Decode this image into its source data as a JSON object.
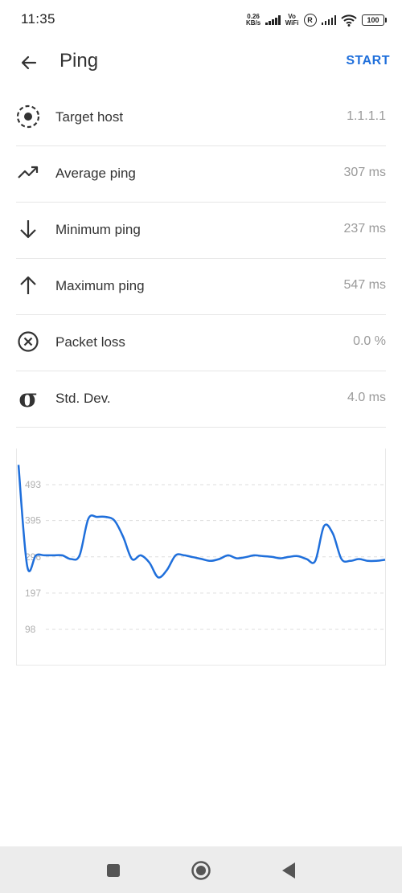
{
  "status_bar": {
    "time": "11:35",
    "speed_value": "0.26",
    "speed_unit": "KB/s",
    "volte_top": "Vo",
    "volte_bottom": "WiFi",
    "roaming": "R",
    "battery": "100"
  },
  "app_bar": {
    "title": "Ping",
    "action_label": "START"
  },
  "stats": [
    {
      "label": "Target host",
      "value": "1.1.1.1",
      "icon": "target-icon"
    },
    {
      "label": "Average ping",
      "value": "307 ms",
      "icon": "trending-up-icon"
    },
    {
      "label": "Minimum ping",
      "value": "237 ms",
      "icon": "arrow-down-icon"
    },
    {
      "label": "Maximum ping",
      "value": "547 ms",
      "icon": "arrow-up-icon"
    },
    {
      "label": "Packet loss",
      "value": "0.0 %",
      "icon": "cancel-circle-icon"
    },
    {
      "label": "Std. Dev.",
      "value": "4.0 ms",
      "icon": "sigma-icon",
      "symbol": "σ"
    }
  ],
  "chart_data": {
    "type": "line",
    "y_ticks": [
      "493",
      "395",
      "296",
      "197",
      "98"
    ],
    "ylim": [
      0,
      560
    ],
    "line_color": "#1f6fdb",
    "grid": "dashed",
    "series": [
      {
        "values": [
          547,
          270,
          300,
          300,
          300,
          300,
          290,
          300,
          400,
          405,
          405,
          395,
          350,
          290,
          300,
          280,
          240,
          260,
          300,
          300,
          295,
          290,
          285,
          290,
          300,
          292,
          295,
          300,
          298,
          296,
          292,
          296,
          298,
          290,
          285,
          380,
          360,
          290,
          285,
          290,
          285,
          285,
          288
        ]
      }
    ]
  },
  "nav_bar": {
    "recents": "square-icon",
    "home": "circle-icon",
    "back": "triangle-back-icon"
  }
}
